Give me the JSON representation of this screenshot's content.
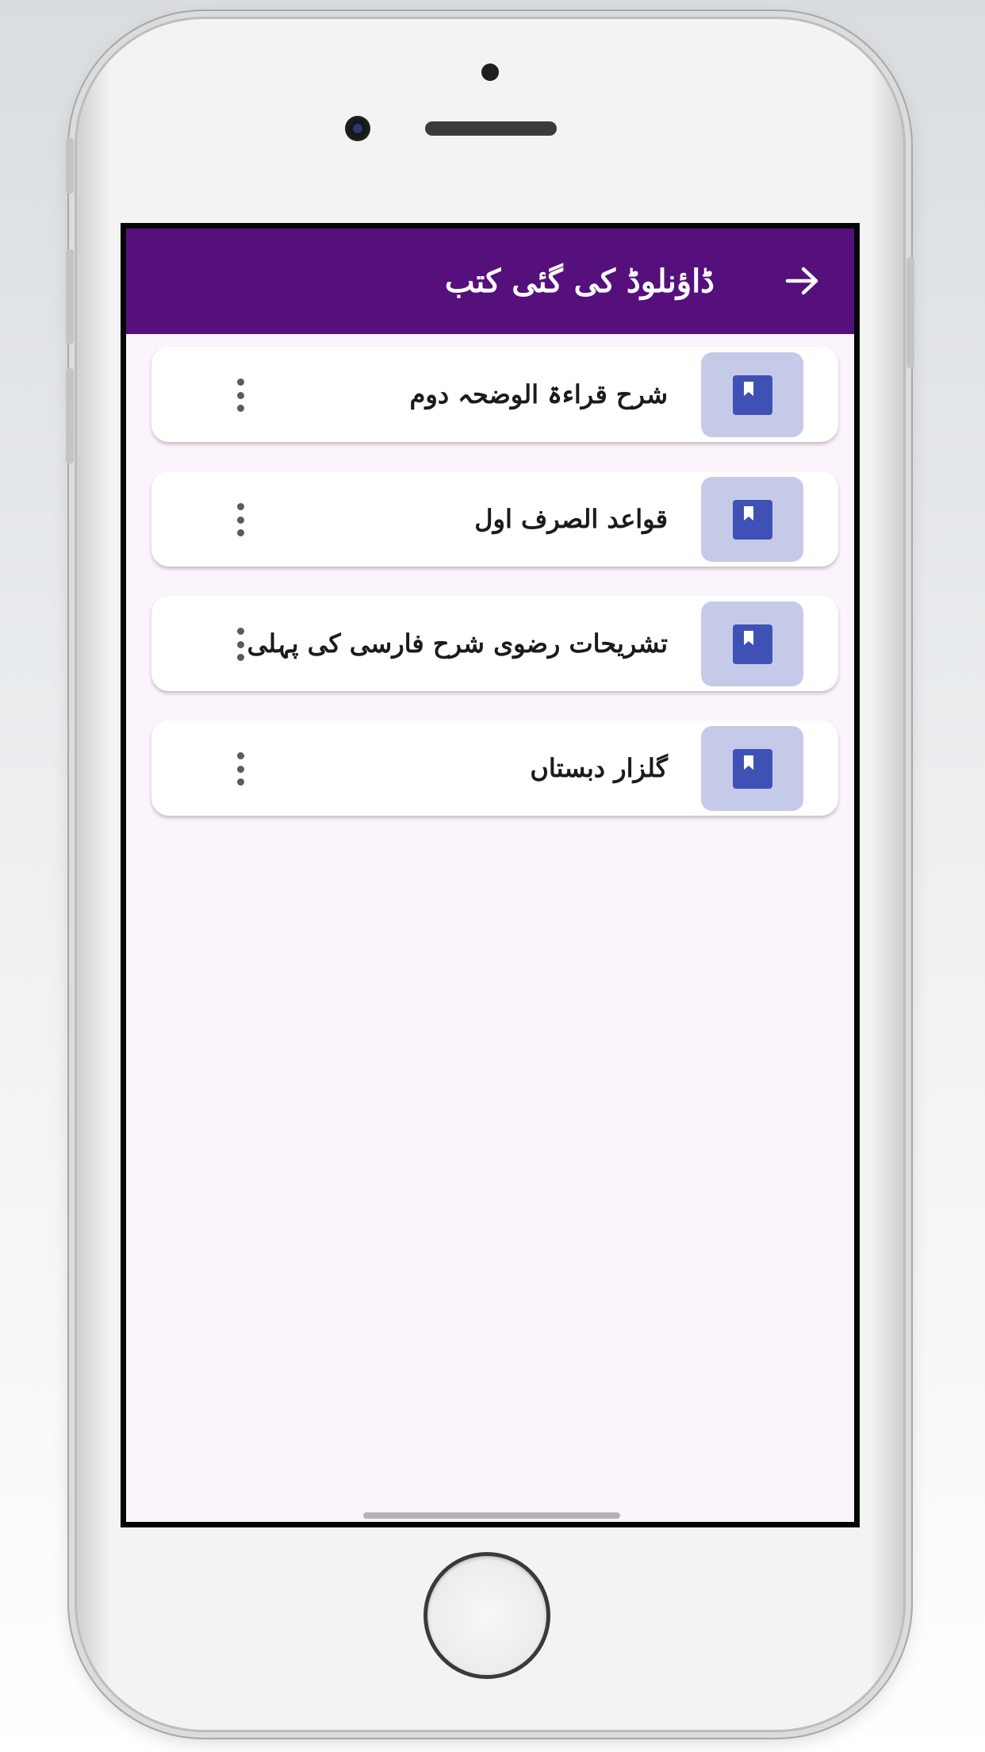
{
  "app_bar": {
    "title": "ڈاؤنلوڈ کی گئی کتب",
    "back_icon": "arrow-right-icon"
  },
  "books": [
    {
      "title": "شرح قراءۃ الوضحہ دوم"
    },
    {
      "title": "قواعد الصرف اول"
    },
    {
      "title": "تشریحات رضوی شرح فارسی کی پہلی"
    },
    {
      "title": "گلزار دبستاں"
    }
  ],
  "icons": {
    "book": "book-icon",
    "more": "more-vert-icon"
  },
  "colors": {
    "app_bar": "#55107c",
    "screen_background": "#fcf4fc",
    "thumb_background": "#c5cae9",
    "book_icon": "#3f51b5"
  }
}
